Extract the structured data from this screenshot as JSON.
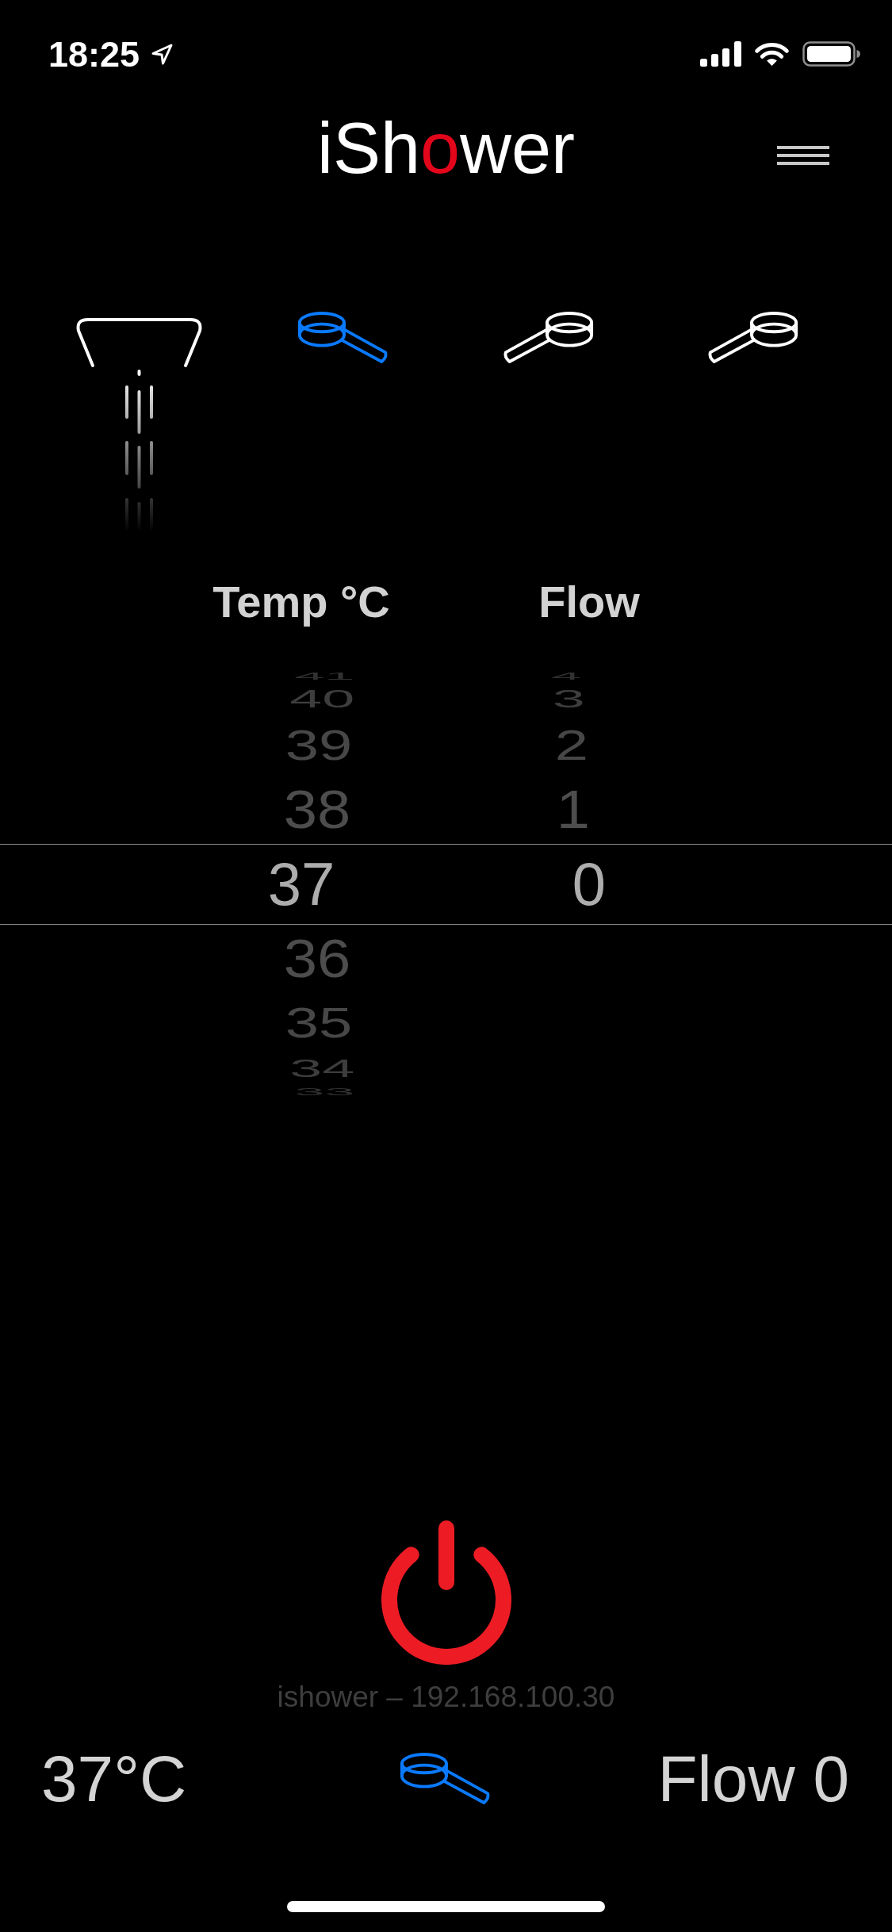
{
  "status_bar": {
    "time": "18:25"
  },
  "header": {
    "logo": [
      {
        "text": "iSh",
        "accent": false
      },
      {
        "text": "o",
        "accent": true
      },
      {
        "text": "wer",
        "accent": false
      }
    ]
  },
  "outlets": [
    {
      "kind": "overhead",
      "selected": false
    },
    {
      "kind": "handheld",
      "mirrored": false,
      "selected": true
    },
    {
      "kind": "handheld",
      "mirrored": true,
      "selected": false
    },
    {
      "kind": "handheld",
      "mirrored": true,
      "selected": false
    }
  ],
  "pickers": [
    {
      "label": "Temp °C",
      "values": [
        {
          "text": "41",
          "selected": false
        },
        {
          "text": "40",
          "selected": false
        },
        {
          "text": "39",
          "selected": false
        },
        {
          "text": "38",
          "selected": false
        },
        {
          "text": "37",
          "selected": true
        },
        {
          "text": "36",
          "selected": false
        },
        {
          "text": "35",
          "selected": false
        },
        {
          "text": "34",
          "selected": false
        },
        {
          "text": "33",
          "selected": false
        }
      ]
    },
    {
      "label": "Flow",
      "values": [
        {
          "text": "4",
          "selected": false
        },
        {
          "text": "3",
          "selected": false
        },
        {
          "text": "2",
          "selected": false
        },
        {
          "text": "1",
          "selected": false
        },
        {
          "text": "0",
          "selected": true
        }
      ]
    }
  ],
  "device_label": "ishower – 192.168.100.30",
  "summary": {
    "temperature": "37°C",
    "flow": "Flow 0"
  }
}
